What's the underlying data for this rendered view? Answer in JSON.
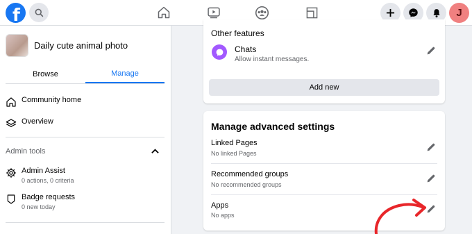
{
  "topbar": {
    "logo_letter": "f",
    "avatar_initial": "J",
    "icons": [
      "facebook-logo",
      "search-icon",
      "home-icon",
      "watch-icon",
      "groups-icon",
      "gaming-icon",
      "plus-icon",
      "messenger-icon",
      "notifications-icon"
    ]
  },
  "sidebar": {
    "group_name": "Daily cute animal photo",
    "tabs": [
      {
        "label": "Browse"
      },
      {
        "label": "Manage"
      }
    ],
    "items": [
      {
        "label": "Community home",
        "icon": "house-icon"
      },
      {
        "label": "Overview",
        "icon": "layers-icon"
      }
    ],
    "admin_tools": {
      "label": "Admin tools",
      "items": [
        {
          "label": "Admin Assist",
          "sub": "0 actions, 0 criteria",
          "icon": "gear-icon"
        },
        {
          "label": "Badge requests",
          "sub": "0 new today",
          "icon": "badge-icon"
        }
      ]
    }
  },
  "other_features": {
    "title": "Other features",
    "chats_title": "Chats",
    "chats_sub": "Allow instant messages.",
    "add_new": "Add new"
  },
  "advanced": {
    "title": "Manage advanced settings",
    "rows": [
      {
        "title": "Linked Pages",
        "sub": "No linked Pages"
      },
      {
        "title": "Recommended groups",
        "sub": "No recommended groups"
      },
      {
        "title": "Apps",
        "sub": "No apps"
      }
    ]
  },
  "colors": {
    "brand": "#1877f2",
    "annotation_arrow": "#e8262a",
    "chats_icon": "#a259ff"
  }
}
